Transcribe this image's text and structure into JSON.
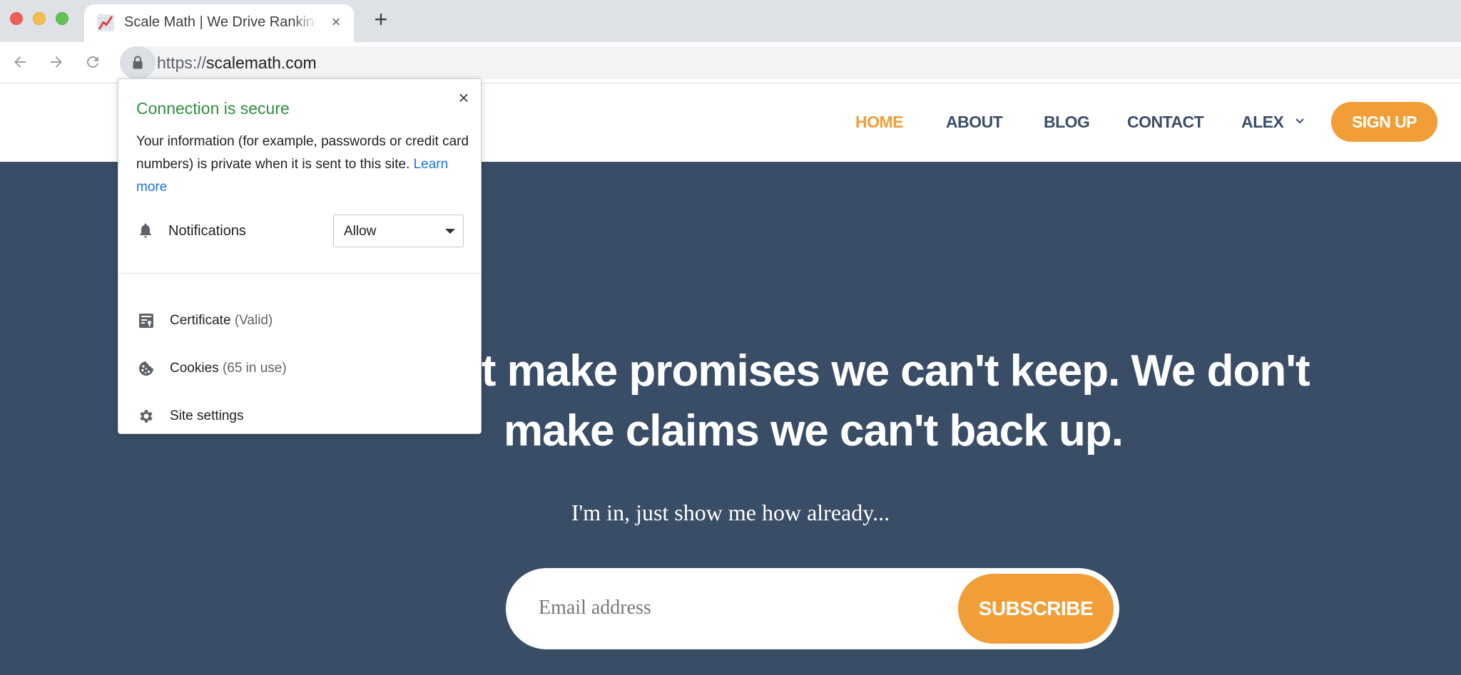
{
  "browser": {
    "tab": {
      "title": "Scale Math | We Drive Rankings",
      "favicon": "chart-increasing-icon",
      "close_label": "×"
    },
    "new_tab_label": "+",
    "url": {
      "scheme": "https://",
      "host": "scalemath.com"
    }
  },
  "site": {
    "nav": [
      {
        "label": "HOME",
        "active": true
      },
      {
        "label": "ABOUT",
        "active": false
      },
      {
        "label": "BLOG",
        "active": false
      },
      {
        "label": "CONTACT",
        "active": false
      },
      {
        "label": "ALEX",
        "active": false
      }
    ],
    "signup_label": "SIGN UP",
    "hero": {
      "headline": "We don't make promises we can't keep. We don't make claims we can't back up.",
      "subline": "I'm in, just show me how already...",
      "email_placeholder": "Email address",
      "subscribe_label": "SUBSCRIBE"
    },
    "colors": {
      "accent": "#f19e38",
      "nav_text": "#3a4e68",
      "hero_bg": "#394d66"
    }
  },
  "page_info_popup": {
    "title": "Connection is secure",
    "description": "Your information (for example, passwords or credit card numbers) is private when it is sent to this site.",
    "learn_more": "Learn more",
    "notifications": {
      "label": "Notifications",
      "value": "Allow"
    },
    "items": [
      {
        "label": "Certificate",
        "sub": "(Valid)",
        "icon": "certificate-icon"
      },
      {
        "label": "Cookies",
        "sub": "(65 in use)",
        "icon": "cookie-icon"
      },
      {
        "label": "Site settings",
        "sub": "",
        "icon": "gear-icon"
      }
    ],
    "close_label": "×",
    "title_color": "#2d8f3e",
    "link_color": "#1a73e8"
  }
}
